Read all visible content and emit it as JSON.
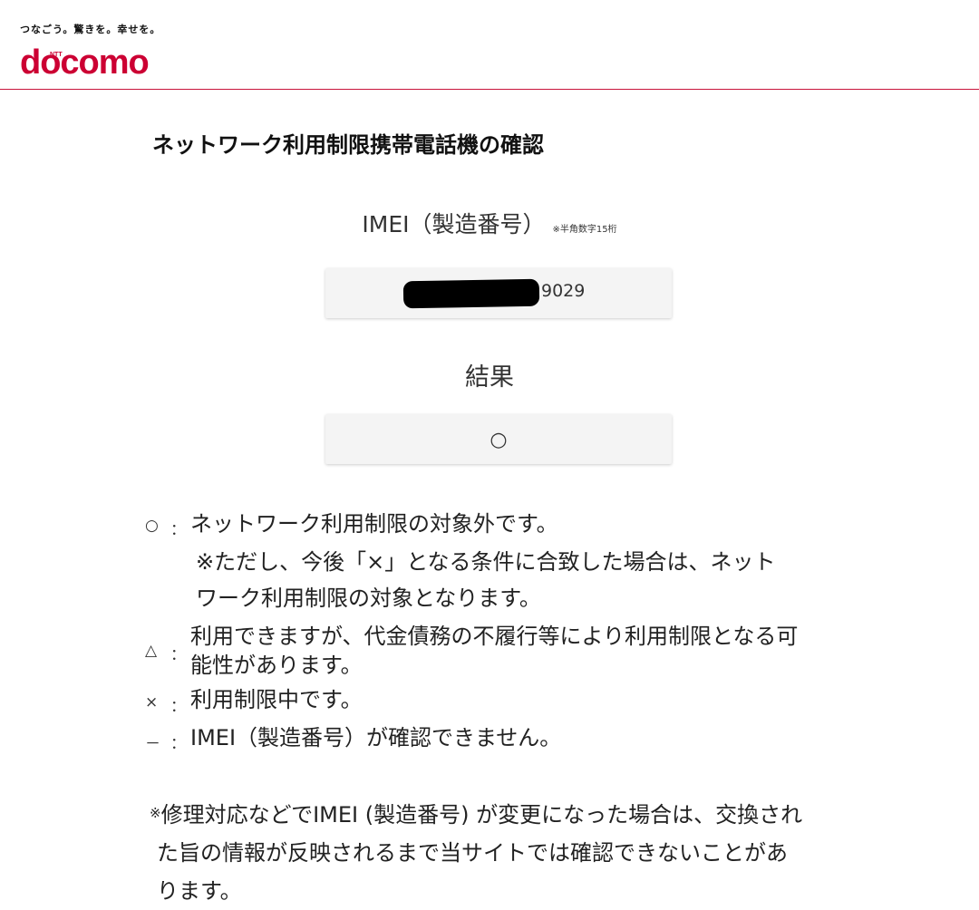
{
  "header": {
    "tagline": "つなごう。驚きを。幸せを。",
    "logo_ntt": "NTT",
    "logo_text": "docomo",
    "border_color": "#c8143c"
  },
  "main": {
    "title": "ネットワーク利用制限携帯電話機の確認",
    "imei_label": "IMEI（製造番号）",
    "imei_note": "※半角数字15桁",
    "imei_value": "9029",
    "result_label": "結果",
    "result_value": "○"
  },
  "legend": [
    {
      "symbol": "○",
      "colon": "：",
      "lines": [
        "ネットワーク利用制限の対象外です。",
        "※ただし、今後「×」となる条件に合致した場合は、ネット",
        "ワーク利用制限の対象となります。"
      ]
    },
    {
      "symbol": "△",
      "colon": "：",
      "lines": [
        "利用できますが、代金債務の不履行等により利用制限となる可",
        "能性があります。"
      ]
    },
    {
      "symbol": "×",
      "colon": "：",
      "lines": [
        "利用制限中です。"
      ]
    },
    {
      "symbol": "－",
      "colon": "：",
      "lines": [
        "IMEI（製造番号）が確認できません。"
      ]
    }
  ],
  "note": {
    "mark": "※",
    "lines": [
      "修理対応などでIMEI (製造番号) が変更になった場合は、交換され",
      "た旨の情報が反映されるまで当サイトでは確認できないことがあ",
      "ります。"
    ]
  }
}
